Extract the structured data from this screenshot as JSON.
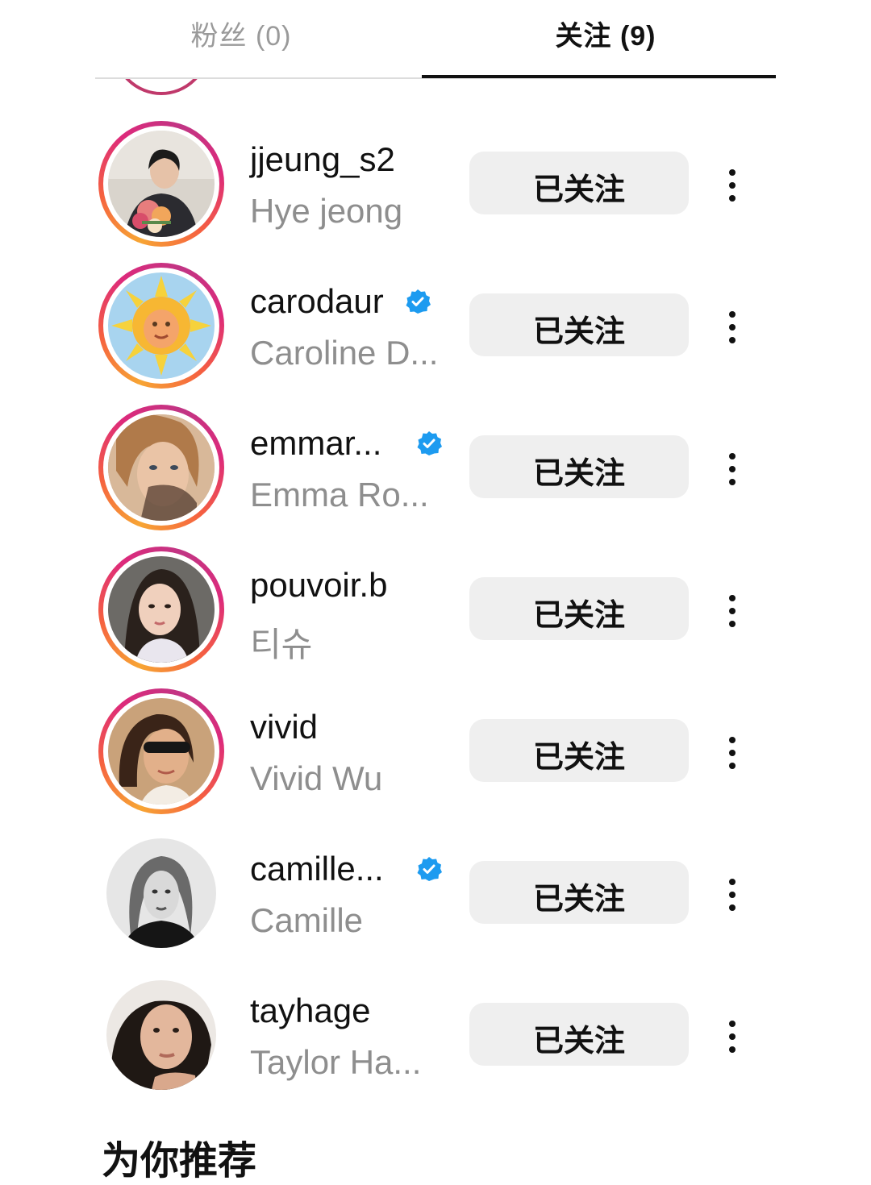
{
  "tabs": {
    "followers_label": "粉丝 (0)",
    "following_label": "关注 (9)"
  },
  "following": [
    {
      "username": "jjeung_s2",
      "fullname": "Hye jeong",
      "verified": false,
      "ring": true,
      "button": "已关注"
    },
    {
      "username": "carodaur",
      "fullname": "Caroline D...",
      "verified": true,
      "ring": true,
      "button": "已关注"
    },
    {
      "username": "emmar...",
      "fullname": "Emma Ro...",
      "verified": true,
      "ring": true,
      "button": "已关注"
    },
    {
      "username": "pouvoir.b",
      "fullname": "티슈",
      "verified": false,
      "ring": true,
      "button": "已关注"
    },
    {
      "username": "vivid",
      "fullname": "Vivid Wu",
      "verified": false,
      "ring": true,
      "button": "已关注"
    },
    {
      "username": "camille...",
      "fullname": "Camille",
      "verified": true,
      "ring": false,
      "button": "已关注"
    },
    {
      "username": "tayhage",
      "fullname": "Taylor Ha...",
      "verified": false,
      "ring": false,
      "button": "已关注"
    }
  ],
  "suggested": {
    "title": "为你推荐"
  },
  "colors": {
    "verified_blue": "#1d9bf0",
    "button_bg": "#efefef",
    "ring_gradient": [
      "#f7a534",
      "#f56040",
      "#dd2a7b",
      "#c13584"
    ]
  },
  "icons": {
    "verified": "verified-badge-icon",
    "more": "more-vertical-icon"
  }
}
